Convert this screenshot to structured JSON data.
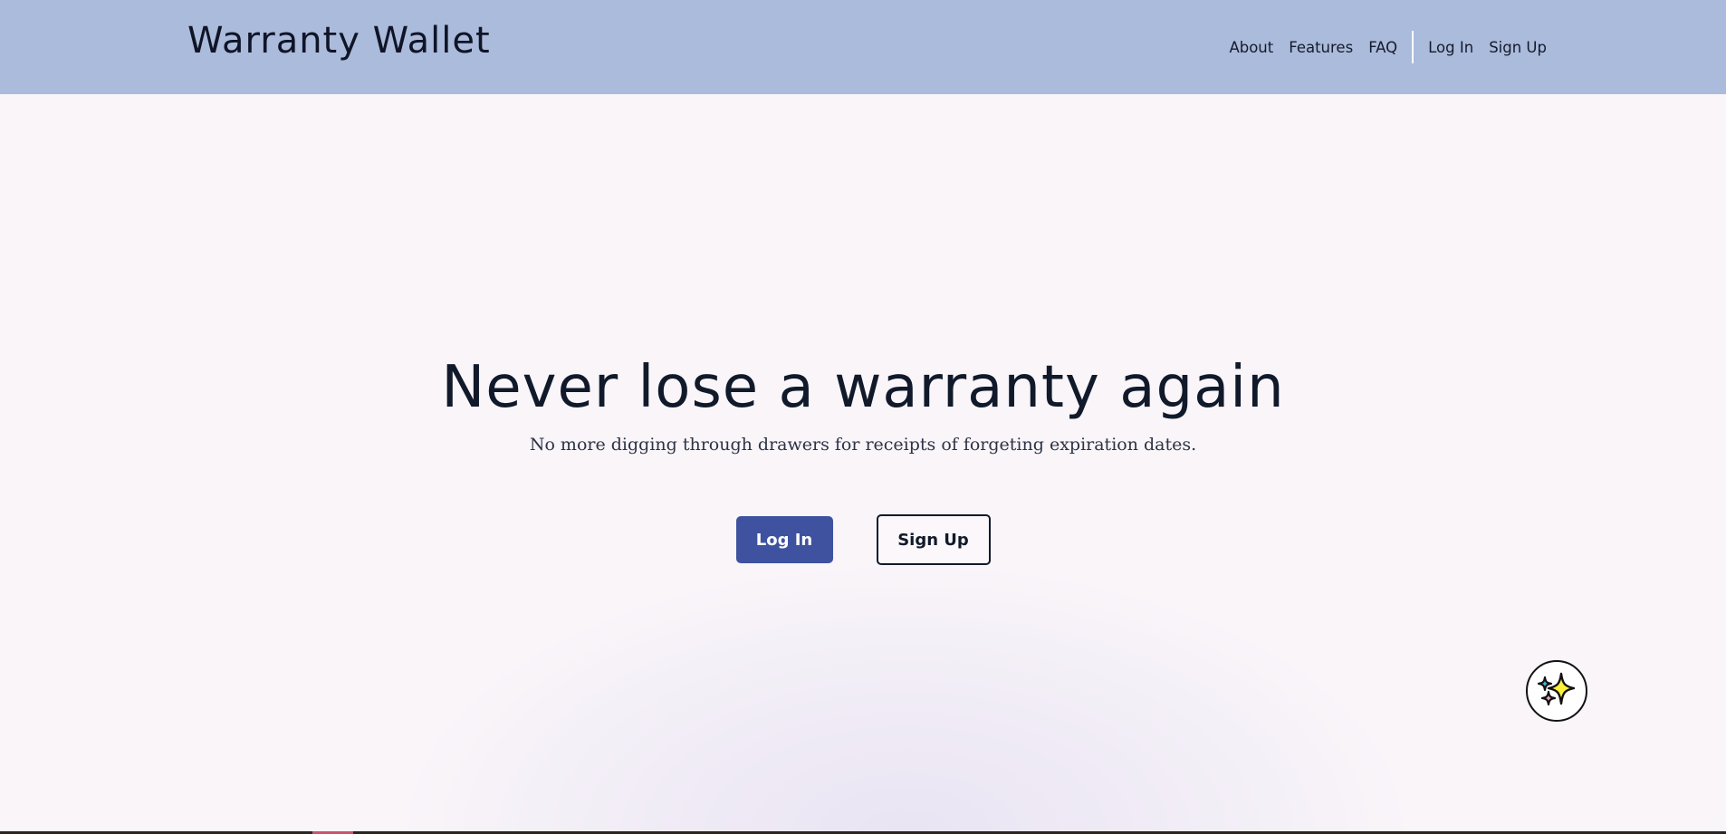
{
  "header": {
    "brand": "Warranty Wallet",
    "nav": {
      "about": "About",
      "features": "Features",
      "faq": "FAQ",
      "login": "Log In",
      "signup": "Sign Up"
    }
  },
  "hero": {
    "title": "Never lose a warranty again",
    "subtitle": "No more digging through drawers for receipts of forgeting expiration dates.",
    "login_button": "Log In",
    "signup_button": "Sign Up"
  },
  "widgets": {
    "assistant_icon": "sparkles-icon"
  },
  "colors": {
    "navbar_bg": "#aabbdb",
    "page_bg": "#f9f5f9",
    "primary_button": "#3e52a0",
    "text_dark": "#111a2b"
  }
}
